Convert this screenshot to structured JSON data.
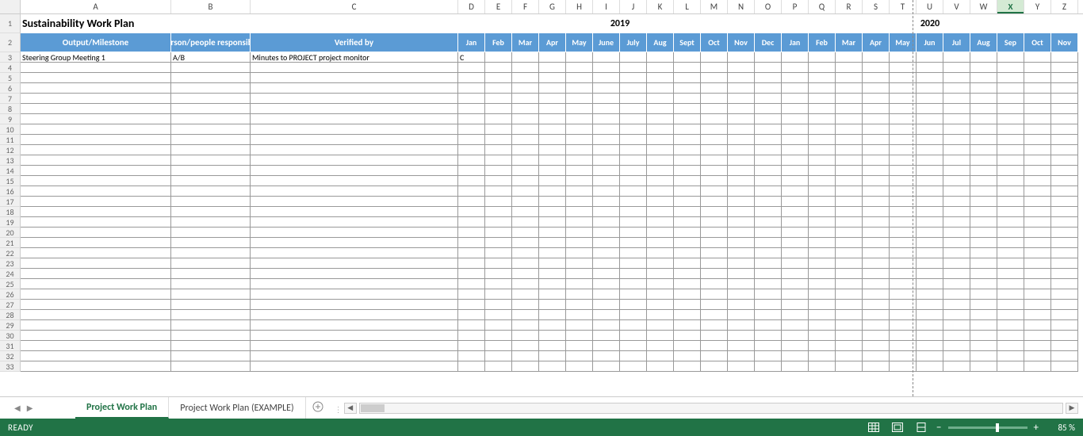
{
  "columns": [
    "A",
    "B",
    "C",
    "D",
    "E",
    "F",
    "G",
    "H",
    "I",
    "J",
    "K",
    "L",
    "M",
    "N",
    "O",
    "P",
    "Q",
    "R",
    "S",
    "T",
    "U",
    "V",
    "W",
    "X",
    "Y",
    "Z"
  ],
  "active_col": "X",
  "row_count": 33,
  "title": "Sustainability Work Plan",
  "year1": "2019",
  "year2": "2020",
  "headers": {
    "output": "Output/Milestone",
    "person": "Person/people responsible",
    "verified": "Verified by"
  },
  "months": [
    "Jan",
    "Feb",
    "Mar",
    "Apr",
    "May",
    "June",
    "July",
    "Aug",
    "Sept",
    "Oct",
    "Nov",
    "Dec",
    "Jan",
    "Feb",
    "Mar",
    "Apr",
    "May",
    "Jun",
    "Jul",
    "Aug",
    "Sep",
    "Oct",
    "Nov"
  ],
  "data_row": {
    "a": "Steering Group Meeting 1",
    "b": "A/B",
    "c": "Minutes to PROJECT project monitor",
    "d": "C"
  },
  "tabs": {
    "active": "Project Work Plan",
    "other": "Project Work Plan (EXAMPLE)"
  },
  "status": "READY",
  "zoom": "85 %"
}
